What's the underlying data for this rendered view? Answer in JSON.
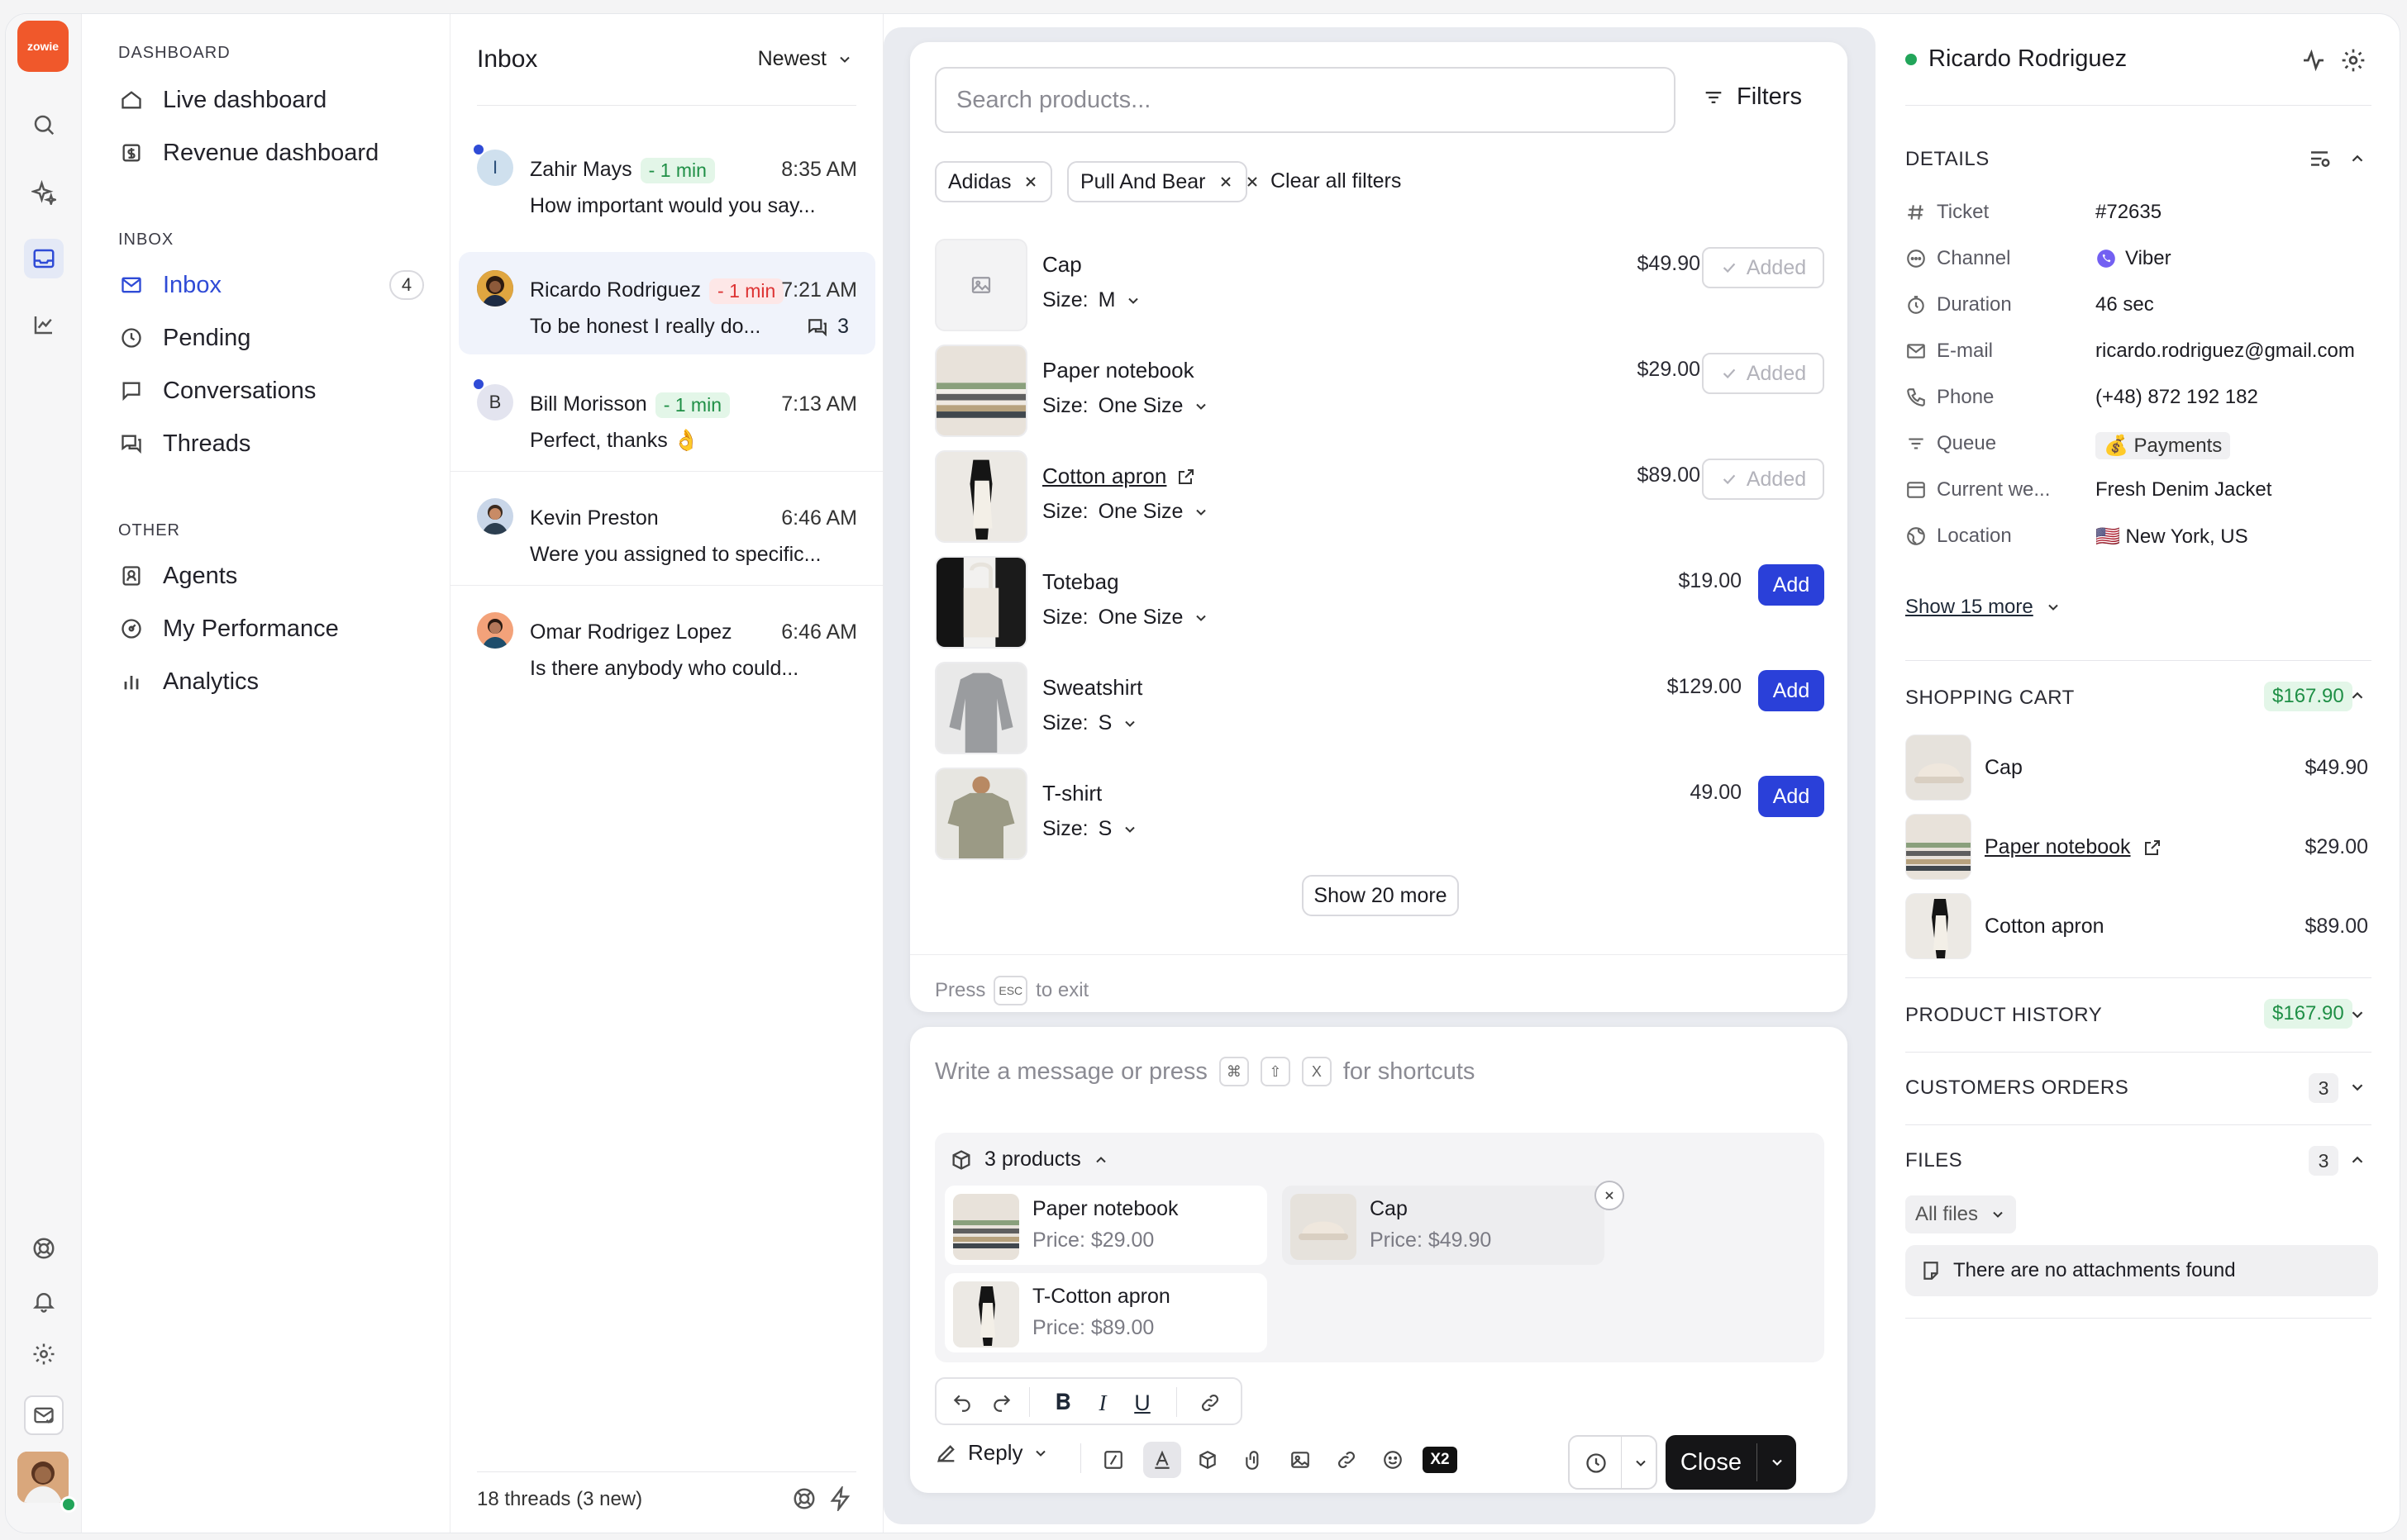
{
  "app": {
    "logo_text": "zowie"
  },
  "nav": {
    "section_dashboard": "DASHBOARD",
    "live_dashboard": "Live dashboard",
    "revenue_dashboard": "Revenue dashboard",
    "section_inbox": "INBOX",
    "inbox": "Inbox",
    "inbox_count": "4",
    "pending": "Pending",
    "conversations": "Conversations",
    "threads": "Threads",
    "section_other": "OTHER",
    "agents": "Agents",
    "my_performance": "My Performance",
    "analytics": "Analytics"
  },
  "inbox": {
    "title": "Inbox",
    "sort": "Newest",
    "footer": "18 threads (3 new)",
    "conversations": [
      {
        "initial": "I",
        "name": "Zahir Mays",
        "sla": "- 1 min",
        "time": "8:35 AM",
        "message": "How important would you say..."
      },
      {
        "name": "Ricardo Rodriguez",
        "sla": "- 1 min",
        "time": "7:21 AM",
        "message": "To be honest I really do...",
        "replies": "3"
      },
      {
        "initial": "B",
        "name": "Bill Morisson",
        "sla": "- 1 min",
        "time": "7:13 AM",
        "message": "Perfect, thanks 👌"
      },
      {
        "name": "Kevin Preston",
        "time": "6:46 AM",
        "message": "Were you assigned to specific..."
      },
      {
        "name": "Omar Rodrigez Lopez",
        "time": "6:46 AM",
        "message": "Is there anybody who could..."
      }
    ]
  },
  "products": {
    "search_placeholder": "Search products...",
    "filters_label": "Filters",
    "chips": [
      "Adidas",
      "Pull And Bear"
    ],
    "clear_all": "Clear all filters",
    "items": [
      {
        "name": "Cap",
        "size_label": "Size:",
        "size": "M",
        "price": "$49.90",
        "action": "Added"
      },
      {
        "name": "Paper notebook",
        "size_label": "Size:",
        "size": "One Size",
        "price": "$29.00",
        "action": "Added"
      },
      {
        "name": "Cotton apron",
        "size_label": "Size:",
        "size": "One Size",
        "price": "$89.00",
        "action": "Added"
      },
      {
        "name": "Totebag",
        "size_label": "Size:",
        "size": "One Size",
        "price": "$19.00",
        "action": "Add"
      },
      {
        "name": "Sweatshirt",
        "size_label": "Size:",
        "size": "S",
        "price": "$129.00",
        "action": "Add"
      },
      {
        "name": "T-shirt",
        "size_label": "Size:",
        "size": "S",
        "price": "49.00",
        "action": "Add"
      }
    ],
    "show_more": "Show 20 more",
    "press": "Press",
    "esc_key": "ESC",
    "to_exit": "to exit"
  },
  "composer": {
    "placeholder_a": "Write a message or press",
    "key1": "⌘",
    "key2": "⇧",
    "key3": "X",
    "placeholder_b": "for shortcuts",
    "attached_count": "3 products",
    "attached": [
      {
        "name": "Paper notebook",
        "price": "Price: $29.00"
      },
      {
        "name": "Cap",
        "price": "Price: $49.90"
      },
      {
        "name": "T-Cotton apron",
        "price": "Price: $89.00"
      }
    ],
    "reply_label": "Reply",
    "x2_label": "X2",
    "close_label": "Close"
  },
  "customer": {
    "name": "Ricardo Rodriguez",
    "details_title": "DETAILS",
    "details": [
      {
        "label": "Ticket",
        "value": "#72635"
      },
      {
        "label": "Channel",
        "value": "Viber"
      },
      {
        "label": "Duration",
        "value": "46 sec"
      },
      {
        "label": "E-mail",
        "value": "ricardo.rodriguez@gmail.com"
      },
      {
        "label": "Phone",
        "value": "(+48) 872 192 182"
      },
      {
        "label": "Queue",
        "value": "💰 Payments"
      },
      {
        "label": "Current we...",
        "value": "Fresh Denim Jacket"
      },
      {
        "label": "Location",
        "value": "🇺🇸 New York, US"
      }
    ],
    "show_more": "Show 15 more",
    "cart_title": "SHOPPING CART",
    "cart_total": "$167.90",
    "cart": [
      {
        "name": "Cap",
        "price": "$49.90"
      },
      {
        "name": "Paper notebook",
        "price": "$29.00"
      },
      {
        "name": "Cotton apron",
        "price": "$89.00"
      }
    ],
    "history_title": "PRODUCT HISTORY",
    "history_total": "$167.90",
    "orders_title": "CUSTOMERS ORDERS",
    "orders_count": "3",
    "files_title": "FILES",
    "files_count": "3",
    "files_filter": "All files",
    "no_attachments": "There are no attachments found"
  },
  "colors": {
    "accent": "#2a40d9",
    "brand": "#f0582b",
    "online": "#22a55a",
    "viber": "#7360f2"
  }
}
